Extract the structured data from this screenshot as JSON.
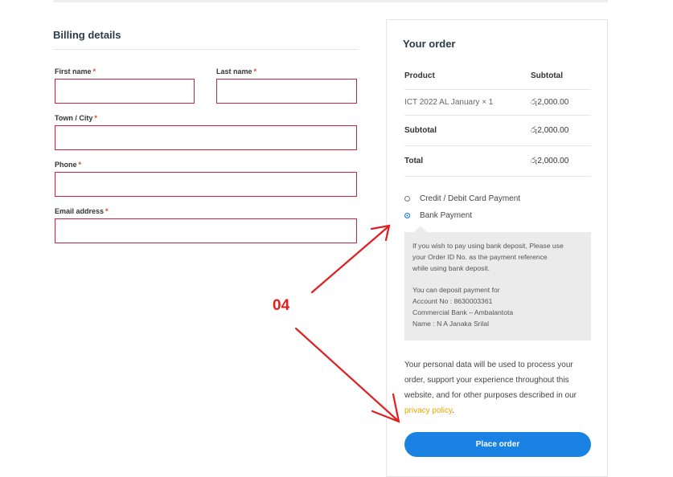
{
  "billing": {
    "title": "Billing details",
    "first_name_label": "First name",
    "last_name_label": "Last name",
    "town_label": "Town / City",
    "phone_label": "Phone",
    "email_label": "Email address",
    "required_mark": "*"
  },
  "order": {
    "title": "Your order",
    "header": {
      "product": "Product",
      "subtotal": "Subtotal"
    },
    "item": {
      "product": "ICT 2022 AL January",
      "qty": "× 1",
      "price": "රු2,000.00"
    },
    "subtotal": {
      "label": "Subtotal",
      "value": "රු2,000.00"
    },
    "total": {
      "label": "Total",
      "value": "රු2,000.00"
    },
    "payment_options": [
      {
        "label": "Credit / Debit Card Payment",
        "selected": false
      },
      {
        "label": "Bank Payment",
        "selected": true
      }
    ],
    "bank_info": {
      "line1": "If you wish to pay using bank deposit, Please use",
      "line2": "your Order ID No. as the payment reference",
      "line3": "while using bank deposit.",
      "line4": "You can deposit payment for",
      "line5": "Account No : 8630003361",
      "line6": "Commercial Bank – Ambalantota",
      "line7": "Name : N A Janaka Srilal"
    },
    "privacy_text": "Your personal data will be used to process your order, support your experience throughout this website, and for other purposes described in our",
    "privacy_link": "privacy policy",
    "privacy_end": ".",
    "place_order": "Place order"
  },
  "annotation": {
    "label": "04",
    "color": "#e02020"
  },
  "colors": {
    "accent": "#1a82e2",
    "error_border": "#d6213d",
    "link": "#e9a400"
  }
}
